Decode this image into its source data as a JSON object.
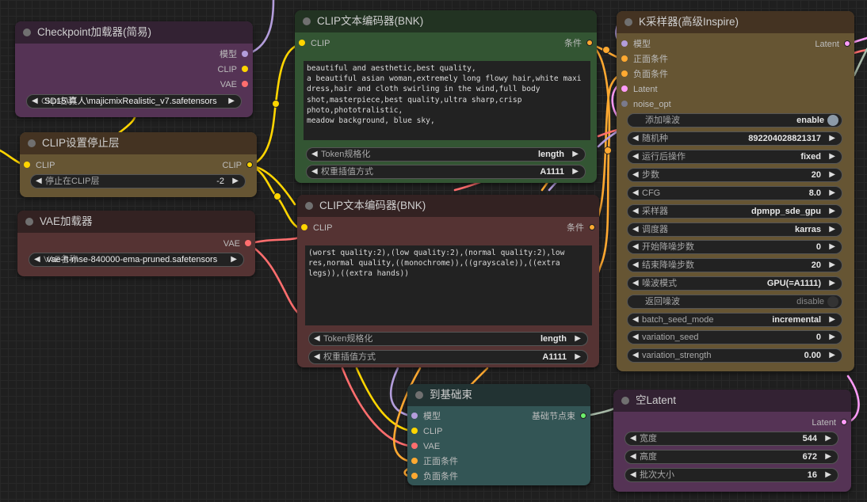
{
  "colors": {
    "model": "#b39ddb",
    "clip": "#ffd500",
    "vae": "#ff6e6e",
    "conditioning": "#ffa931",
    "latent": "#ff9cf9",
    "noise": "#7a7a8c",
    "pipe": "#6cf06c",
    "pipe_wire": "#a6b8a6"
  },
  "nodes": {
    "checkpoint": {
      "title": "Checkpoint加载器(简易)",
      "outputs": [
        "模型",
        "CLIP",
        "VAE"
      ],
      "ckpt_label": "Ckpt名称",
      "ckpt_value": "SD15\\真人\\majicmixRealistic_v7.safetensors"
    },
    "clip_stop": {
      "title": "CLIP设置停止层",
      "input": "CLIP",
      "output": "CLIP",
      "widget_label": "停止在CLIP层",
      "widget_value": "-2"
    },
    "vae_loader": {
      "title": "VAE加载器",
      "output": "VAE",
      "vae_label": "VAE名称",
      "vae_value": "vae-ft-mse-840000-ema-pruned.safetensors"
    },
    "clip_pos": {
      "title": "CLIP文本编码器(BNK)",
      "input": "CLIP",
      "output": "条件",
      "text": "beautiful and aesthetic,best quality,\na beautiful asian woman,extremely long flowy hair,white maxi dress,hair and cloth swirling in the wind,full body shot,masterpiece,best quality,ultra sharp,crisp photo,phototralistic,\nmeadow background, blue sky,",
      "token_label": "Token规格化",
      "token_value": "length",
      "weight_label": "权重插值方式",
      "weight_value": "A1111"
    },
    "clip_neg": {
      "title": "CLIP文本编码器(BNK)",
      "input": "CLIP",
      "output": "条件",
      "text": "(worst quality:2),(low quality:2),(normal quality:2),low res,normal quality,((monochrome)),((grayscale)),((extra legs)),((extra hands))",
      "token_label": "Token规格化",
      "token_value": "length",
      "weight_label": "权重插值方式",
      "weight_value": "A1111"
    },
    "ksampler": {
      "title": "K采样器(高级Inspire)",
      "inputs": [
        "模型",
        "正面条件",
        "负面条件",
        "Latent",
        "noise_opt"
      ],
      "output": "Latent",
      "widgets": [
        {
          "label": "添加噪波",
          "value": "enable",
          "type": "toggle",
          "on": true
        },
        {
          "label": "随机种",
          "value": "892204028821317",
          "type": "number"
        },
        {
          "label": "运行后操作",
          "value": "fixed",
          "type": "combo"
        },
        {
          "label": "步数",
          "value": "20",
          "type": "number"
        },
        {
          "label": "CFG",
          "value": "8.0",
          "type": "number"
        },
        {
          "label": "采样器",
          "value": "dpmpp_sde_gpu",
          "type": "combo"
        },
        {
          "label": "调度器",
          "value": "karras",
          "type": "combo"
        },
        {
          "label": "开始降噪步数",
          "value": "0",
          "type": "number"
        },
        {
          "label": "结束降噪步数",
          "value": "20",
          "type": "number"
        },
        {
          "label": "噪波模式",
          "value": "GPU(=A1111)",
          "type": "combo"
        },
        {
          "label": "返回噪波",
          "value": "disable",
          "type": "toggle",
          "on": false
        },
        {
          "label": "batch_seed_mode",
          "value": "incremental",
          "type": "combo"
        },
        {
          "label": "variation_seed",
          "value": "0",
          "type": "number"
        },
        {
          "label": "variation_strength",
          "value": "0.00",
          "type": "number"
        }
      ]
    },
    "to_pipe": {
      "title": "到基础束",
      "inputs": [
        "模型",
        "CLIP",
        "VAE",
        "正面条件",
        "负面条件"
      ],
      "output": "基础节点束"
    },
    "empty_latent": {
      "title": "空Latent",
      "output": "Latent",
      "widgets": [
        {
          "label": "宽度",
          "value": "544"
        },
        {
          "label": "高度",
          "value": "672"
        },
        {
          "label": "批次大小",
          "value": "16"
        }
      ]
    }
  }
}
